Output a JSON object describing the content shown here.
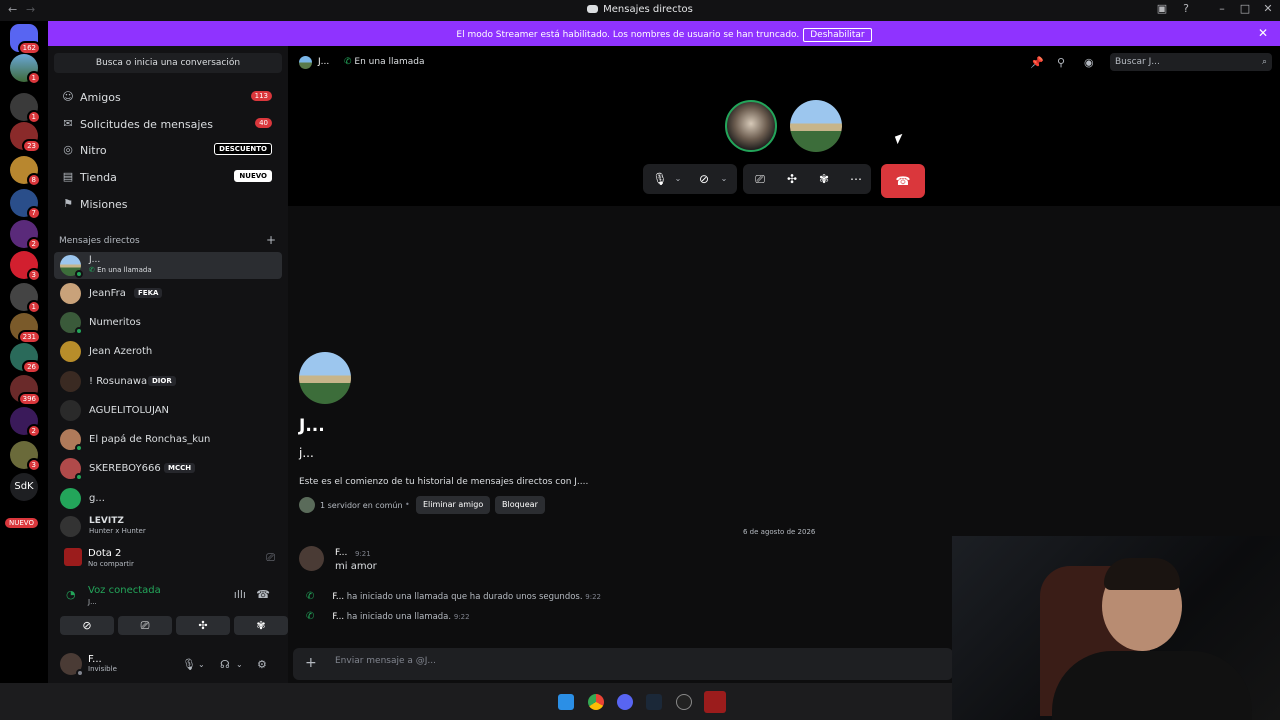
{
  "window": {
    "title": "Mensajes directos"
  },
  "banner": {
    "message": "El modo Streamer está habilitado. Los nombres de usuario se han truncado.",
    "disable_label": "Deshabilitar"
  },
  "rail": {
    "badges": [
      "162",
      "1",
      "1",
      "23",
      "8",
      "7",
      "2",
      "3",
      "1",
      "231",
      "26",
      "396",
      "2",
      "3"
    ],
    "text_server": "SdK",
    "nuevo": "NUEVO"
  },
  "sidebar": {
    "search_label": "Busca o inicia una conversación",
    "nav": [
      {
        "label": "Amigos",
        "count": "113"
      },
      {
        "label": "Solicitudes de mensajes",
        "count": "40"
      },
      {
        "label": "Nitro",
        "tag": "DESCUENTO"
      },
      {
        "label": "Tienda",
        "tag": "NUEVO"
      },
      {
        "label": "Misiones"
      }
    ],
    "dm_header": "Mensajes directos",
    "dms": [
      {
        "name": "J...",
        "sub": "En una llamada"
      },
      {
        "name": "JeanFra",
        "tag": "FEKA"
      },
      {
        "name": "Numeritos"
      },
      {
        "name": "Jean Azeroth"
      },
      {
        "name": "! Rosunawa",
        "tag": "DIOR"
      },
      {
        "name": "AGUELITOLUJAN"
      },
      {
        "name": "El papá de Ronchas_kun"
      },
      {
        "name": "SKEREBOY666",
        "tag": "MCCH"
      },
      {
        "name": "g..."
      },
      {
        "name": "LEVITZ",
        "sub": "Hunter x Hunter"
      }
    ]
  },
  "activity": {
    "game": "Dota 2",
    "status": "No compartir"
  },
  "voice": {
    "label": "Voz conectada",
    "sub": "J..."
  },
  "user": {
    "name": "F...",
    "status": "Invisible"
  },
  "header": {
    "name": "J...",
    "call_status": "En una llamada",
    "search_placeholder": "Buscar J..."
  },
  "chat": {
    "welcome_name": "J...",
    "welcome_handle": "j...",
    "welcome_text": "Este es el comienzo de tu historial de mensajes directos con J....",
    "mutual": "1 servidor en común",
    "remove_friend": "Eliminar amigo",
    "block": "Bloquear",
    "date": "6 de agosto de 2026",
    "message": {
      "author": "F...",
      "time": "9:21",
      "text": "mi amor"
    },
    "system": [
      {
        "author": "F...",
        "text": " ha iniciado una llamada que ha durado unos segundos.",
        "time": "9:22"
      },
      {
        "author": "F...",
        "text": " ha iniciado una llamada.",
        "time": "9:22"
      }
    ],
    "composer_placeholder": "Enviar mensaje a @J..."
  }
}
